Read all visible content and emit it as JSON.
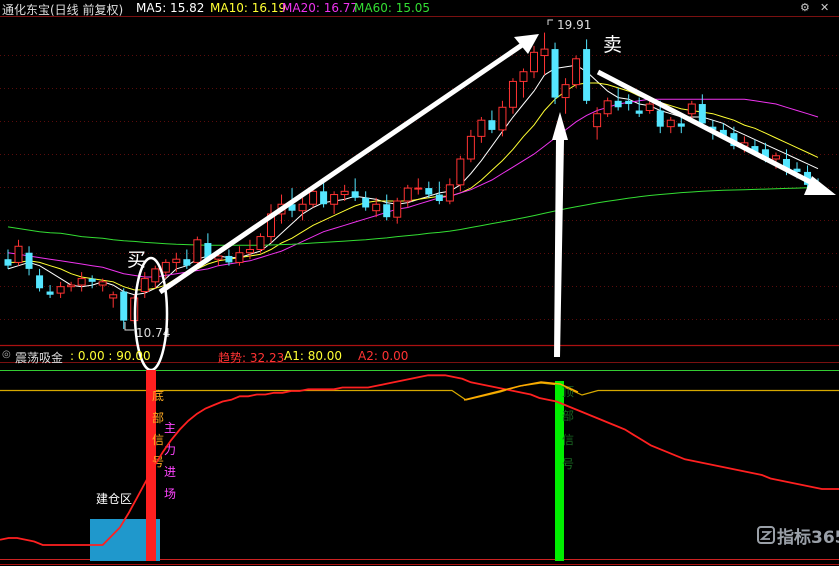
{
  "header": {
    "stock_title": "通化东宝(日线 前复权)",
    "ma5": "MA5: 15.82",
    "ma10": "MA10: 16.19",
    "ma20": "MA20: 16.77",
    "ma60": "MA60: 15.05"
  },
  "sub_header": {
    "indicator_name": "震荡吸金",
    "params": ": 0.00 : 90.00",
    "trend": "趋势: 32.23",
    "a1": "A1: 80.00",
    "a2": "A2: 0.00"
  },
  "colors": {
    "up": "#ff3333",
    "down": "#55e6ff",
    "ma5": "#ffffff",
    "ma10": "#ffff33",
    "ma20": "#ee33ee",
    "ma60": "#33dd33",
    "trend": "#ff2020",
    "bottom_signal": "#ff2020",
    "top_signal": "#00ee00",
    "build_zone": "#1f98cc"
  },
  "annotations": {
    "buy": "买",
    "sell": "卖",
    "low_label": "10.74",
    "high_label": "19.91",
    "bottom_signal_text": "底部信号",
    "main_force_text": "主力进场",
    "top_signal_text": "顶部信号",
    "build_zone_text": "建仓区"
  },
  "watermark": "指标365",
  "chart_data": [
    {
      "type": "candlestick",
      "title": "通化东宝(日线 前复权)",
      "ylim": [
        10.4,
        20.3
      ],
      "ohlc": [
        [
          12.9,
          13.2,
          12.6,
          12.7
        ],
        [
          12.8,
          13.5,
          12.7,
          13.3
        ],
        [
          13.1,
          13.3,
          12.4,
          12.6
        ],
        [
          12.4,
          12.6,
          11.9,
          12.0
        ],
        [
          11.9,
          12.1,
          11.7,
          11.8
        ],
        [
          11.85,
          12.2,
          11.7,
          12.05
        ],
        [
          12.05,
          12.2,
          11.9,
          12.1
        ],
        [
          12.1,
          12.5,
          11.9,
          12.3
        ],
        [
          12.3,
          12.4,
          12.0,
          12.2
        ],
        [
          12.1,
          12.3,
          11.9,
          12.2
        ],
        [
          11.7,
          11.9,
          11.4,
          11.8
        ],
        [
          11.9,
          12.0,
          10.74,
          11.0
        ],
        [
          11.0,
          11.8,
          10.9,
          11.7
        ],
        [
          11.9,
          12.5,
          11.7,
          12.3
        ],
        [
          12.2,
          12.7,
          12.0,
          12.6
        ],
        [
          12.5,
          12.9,
          12.3,
          12.8
        ],
        [
          12.8,
          13.1,
          12.5,
          12.9
        ],
        [
          12.9,
          13.2,
          12.6,
          12.7
        ],
        [
          12.8,
          13.6,
          12.6,
          13.5
        ],
        [
          13.4,
          13.7,
          12.8,
          12.9
        ],
        [
          12.9,
          13.1,
          12.7,
          13.0
        ],
        [
          13.0,
          13.2,
          12.7,
          12.8
        ],
        [
          12.8,
          13.3,
          12.7,
          13.1
        ],
        [
          13.1,
          13.5,
          12.9,
          13.2
        ],
        [
          13.2,
          13.7,
          13.1,
          13.6
        ],
        [
          13.6,
          14.6,
          13.4,
          14.3
        ],
        [
          14.3,
          14.9,
          14.0,
          14.6
        ],
        [
          14.6,
          15.1,
          14.2,
          14.4
        ],
        [
          14.4,
          14.8,
          14.1,
          14.6
        ],
        [
          14.6,
          15.2,
          14.5,
          15.0
        ],
        [
          15.0,
          15.4,
          14.5,
          14.6
        ],
        [
          14.6,
          15.0,
          14.3,
          14.9
        ],
        [
          14.9,
          15.2,
          14.7,
          15.0
        ],
        [
          15.0,
          15.4,
          14.7,
          14.8
        ],
        [
          14.8,
          15.0,
          14.4,
          14.5
        ],
        [
          14.4,
          14.8,
          14.2,
          14.6
        ],
        [
          14.6,
          14.9,
          14.1,
          14.2
        ],
        [
          14.2,
          14.8,
          14.0,
          14.7
        ],
        [
          14.7,
          15.2,
          14.5,
          15.1
        ],
        [
          15.1,
          15.4,
          14.9,
          15.1
        ],
        [
          15.1,
          15.3,
          14.8,
          14.9
        ],
        [
          14.9,
          15.3,
          14.6,
          14.7
        ],
        [
          14.7,
          15.4,
          14.6,
          15.2
        ],
        [
          15.2,
          16.1,
          15.0,
          16.0
        ],
        [
          16.0,
          16.9,
          15.9,
          16.7
        ],
        [
          16.7,
          17.3,
          16.5,
          17.2
        ],
        [
          17.2,
          17.5,
          16.8,
          16.9
        ],
        [
          16.9,
          17.8,
          16.7,
          17.6
        ],
        [
          17.6,
          18.5,
          17.4,
          18.4
        ],
        [
          18.4,
          18.8,
          17.9,
          18.7
        ],
        [
          18.7,
          19.5,
          18.5,
          19.3
        ],
        [
          19.2,
          19.91,
          18.6,
          19.4
        ],
        [
          19.4,
          19.6,
          17.7,
          17.9
        ],
        [
          17.9,
          18.5,
          17.4,
          18.3
        ],
        [
          18.3,
          19.2,
          18.2,
          19.1
        ],
        [
          19.4,
          19.7,
          17.7,
          17.8
        ],
        [
          17.0,
          17.6,
          16.6,
          17.4
        ],
        [
          17.4,
          17.9,
          17.3,
          17.8
        ],
        [
          17.8,
          18.2,
          17.5,
          17.6
        ],
        [
          17.8,
          18.0,
          17.5,
          17.7
        ],
        [
          17.5,
          17.9,
          17.3,
          17.4
        ],
        [
          17.5,
          17.9,
          17.4,
          17.7
        ],
        [
          17.5,
          17.8,
          16.8,
          17.0
        ],
        [
          17.0,
          17.3,
          16.8,
          17.2
        ],
        [
          17.1,
          17.4,
          16.8,
          17.0
        ],
        [
          17.4,
          17.8,
          17.2,
          17.7
        ],
        [
          17.7,
          18.0,
          17.0,
          17.1
        ],
        [
          17.0,
          17.2,
          16.6,
          16.9
        ],
        [
          16.9,
          17.1,
          16.6,
          16.7
        ],
        [
          16.8,
          17.0,
          16.3,
          16.4
        ],
        [
          16.4,
          16.7,
          16.2,
          16.5
        ],
        [
          16.4,
          16.6,
          16.1,
          16.2
        ],
        [
          16.3,
          16.5,
          15.9,
          16.0
        ],
        [
          16.0,
          16.2,
          15.7,
          16.1
        ],
        [
          16.0,
          16.3,
          15.5,
          15.7
        ],
        [
          15.7,
          15.9,
          15.4,
          15.6
        ],
        [
          15.6,
          15.8,
          15.1,
          15.2
        ],
        [
          15.2,
          15.4,
          14.9,
          15.0
        ]
      ],
      "series": [
        {
          "name": "MA5",
          "values": [
            12.6,
            12.7,
            12.8,
            12.7,
            12.5,
            12.3,
            12.1,
            12.05,
            12.1,
            12.2,
            12.1,
            11.9,
            11.8,
            11.85,
            12.0,
            12.3,
            12.6,
            12.7,
            12.9,
            13.0,
            13.0,
            12.95,
            12.95,
            13.05,
            13.15,
            13.4,
            13.7,
            14.0,
            14.3,
            14.5,
            14.65,
            14.7,
            14.75,
            14.85,
            14.8,
            14.75,
            14.65,
            14.6,
            14.65,
            14.75,
            14.85,
            14.95,
            15.0,
            15.2,
            15.55,
            15.95,
            16.4,
            16.85,
            17.3,
            17.7,
            18.1,
            18.6,
            18.8,
            18.85,
            18.9,
            18.7,
            18.4,
            18.1,
            17.9,
            17.85,
            17.7,
            17.65,
            17.5,
            17.4,
            17.3,
            17.3,
            17.3,
            17.2,
            17.1,
            16.9,
            16.75,
            16.6,
            16.45,
            16.3,
            16.15,
            16.0,
            15.85,
            15.7
          ]
        },
        {
          "name": "MA10",
          "values": [
            12.8,
            12.8,
            12.85,
            12.8,
            12.7,
            12.6,
            12.45,
            12.35,
            12.3,
            12.25,
            12.2,
            12.05,
            11.95,
            11.95,
            12.0,
            12.1,
            12.3,
            12.45,
            12.6,
            12.75,
            12.85,
            12.9,
            12.95,
            13.0,
            13.05,
            13.2,
            13.4,
            13.55,
            13.75,
            13.95,
            14.1,
            14.25,
            14.4,
            14.55,
            14.65,
            14.7,
            14.7,
            14.7,
            14.7,
            14.75,
            14.8,
            14.85,
            14.85,
            14.95,
            15.1,
            15.35,
            15.65,
            15.95,
            16.3,
            16.7,
            17.05,
            17.5,
            17.85,
            18.1,
            18.3,
            18.35,
            18.35,
            18.3,
            18.2,
            18.1,
            17.95,
            17.85,
            17.75,
            17.65,
            17.55,
            17.5,
            17.45,
            17.4,
            17.3,
            17.2,
            17.05,
            16.95,
            16.8,
            16.65,
            16.5,
            16.35,
            16.2,
            16.05
          ]
        },
        {
          "name": "MA20",
          "values": [
            13.1,
            13.05,
            13.0,
            12.95,
            12.9,
            12.85,
            12.8,
            12.75,
            12.7,
            12.65,
            12.55,
            12.45,
            12.4,
            12.35,
            12.35,
            12.4,
            12.45,
            12.5,
            12.55,
            12.6,
            12.7,
            12.75,
            12.8,
            12.85,
            12.95,
            13.05,
            13.15,
            13.3,
            13.45,
            13.6,
            13.75,
            13.85,
            13.95,
            14.05,
            14.15,
            14.25,
            14.35,
            14.45,
            14.5,
            14.6,
            14.7,
            14.8,
            14.85,
            14.95,
            15.05,
            15.2,
            15.35,
            15.55,
            15.75,
            15.95,
            16.15,
            16.4,
            16.65,
            16.9,
            17.15,
            17.35,
            17.5,
            17.6,
            17.7,
            17.75,
            17.8,
            17.85,
            17.85,
            17.85,
            17.85,
            17.85,
            17.85,
            17.85,
            17.85,
            17.85,
            17.85,
            17.8,
            17.75,
            17.7,
            17.6,
            17.5,
            17.4,
            17.3
          ]
        },
        {
          "name": "MA60",
          "values": [
            13.9,
            13.85,
            13.8,
            13.75,
            13.72,
            13.7,
            13.65,
            13.6,
            13.57,
            13.55,
            13.5,
            13.47,
            13.45,
            13.42,
            13.4,
            13.38,
            13.36,
            13.35,
            13.34,
            13.33,
            13.33,
            13.33,
            13.33,
            13.33,
            13.33,
            13.34,
            13.35,
            13.36,
            13.38,
            13.4,
            13.42,
            13.44,
            13.46,
            13.48,
            13.5,
            13.53,
            13.56,
            13.6,
            13.63,
            13.66,
            13.7,
            13.73,
            13.77,
            13.82,
            13.88,
            13.94,
            14.0,
            14.06,
            14.12,
            14.18,
            14.25,
            14.32,
            14.39,
            14.46,
            14.52,
            14.58,
            14.64,
            14.69,
            14.74,
            14.79,
            14.83,
            14.87,
            14.9,
            14.93,
            14.96,
            14.98,
            15.0,
            15.02,
            15.03,
            15.04,
            15.05,
            15.06,
            15.07,
            15.08,
            15.09,
            15.1,
            15.11,
            15.12
          ]
        }
      ]
    },
    {
      "type": "line",
      "title": "震荡吸金",
      "ylim": [
        -8,
        100
      ],
      "series": [
        {
          "name": "趋势",
          "values": [
            3,
            4,
            4,
            3,
            2,
            0,
            0,
            0,
            0,
            0,
            0,
            0,
            0,
            5,
            10,
            18,
            27,
            36,
            45,
            53,
            60,
            66,
            71,
            75,
            78,
            80,
            82,
            83,
            85,
            85,
            86,
            86,
            87,
            87,
            88,
            88,
            89,
            89,
            89,
            89,
            90,
            90,
            90,
            90,
            91,
            92,
            93,
            94,
            95,
            96,
            97,
            97,
            97,
            96,
            95,
            93,
            92,
            91,
            90,
            89,
            88,
            87,
            86,
            84,
            83,
            82,
            80,
            78,
            76,
            74,
            72,
            70,
            68,
            66,
            63,
            60,
            57,
            55,
            53,
            51,
            49,
            48,
            47,
            46,
            45,
            44,
            43,
            42,
            41,
            40,
            38,
            37,
            36,
            35,
            34,
            33,
            32,
            32,
            32
          ]
        },
        {
          "name": "A1",
          "values": [
            80
          ]
        },
        {
          "name": "A2",
          "values": [
            0
          ]
        }
      ]
    }
  ]
}
